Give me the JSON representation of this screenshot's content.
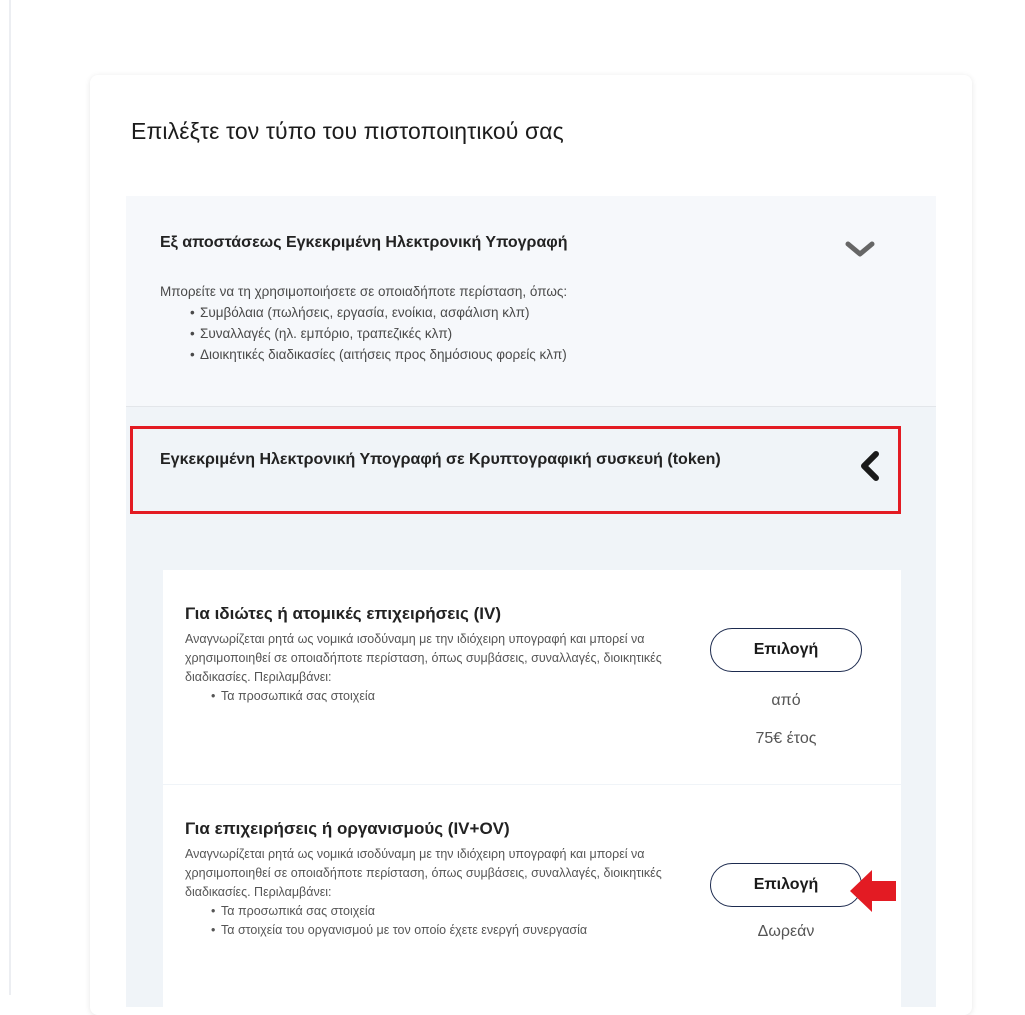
{
  "page": {
    "title": "Επιλέξτε τον τύπο του πιστοποιητικού σας"
  },
  "accordion": [
    {
      "title": "Εξ αποστάσεως Εγκεκριμένη Ηλεκτρονική Υπογραφή",
      "chevron_icon": "chevron-down-icon",
      "description_intro": "Μπορείτε να τη χρησιμοποιήσετε σε οποιαδήποτε περίσταση, όπως:",
      "bullets": [
        "Συμβόλαια (πωλήσεις, εργασία, ενοίκια, ασφάλιση κλπ)",
        "Συναλλαγές (ηλ. εμπόριο, τραπεζικές κλπ)",
        "Διοικητικές διαδικασίες (αιτήσεις προς δημόσιους φορείς κλπ)"
      ]
    },
    {
      "title": "Εγκεκριμένη Ηλεκτρονική Υπογραφή σε Κρυπτογραφική συσκευή (token)",
      "chevron_icon": "chevron-left-icon",
      "highlight_color": "#e31b23"
    }
  ],
  "options": [
    {
      "title": "Για ιδιώτες ή ατομικές επιχειρήσεις (IV)",
      "description": "Αναγνωρίζεται ρητά ως νομικά ισοδύναμη με την ιδιόχειρη υπογραφή και μπορεί να χρησιμοποιηθεί σε οποιαδήποτε περίσταση, όπως συμβάσεις, συναλλαγές, διοικητικές διαδικασίες. Περιλαμβάνει:",
      "bullets": [
        "Τα προσωπικά σας στοιχεία"
      ],
      "button_label": "Επιλογή",
      "price_prefix": "από",
      "price": "75€ έτος"
    },
    {
      "title": "Για επιχειρήσεις ή οργανισμούς (IV+OV)",
      "description": "Αναγνωρίζεται ρητά ως νομικά ισοδύναμη με την ιδιόχειρη υπογραφή και μπορεί να χρησιμοποιηθεί σε οποιαδήποτε περίσταση, όπως συμβάσεις, συναλλαγές, διοικητικές διαδικασίες. Περιλαμβάνει:",
      "bullets": [
        "Τα προσωπικά σας στοιχεία",
        "Τα στοιχεία του οργανισμού με τον οποίο έχετε ενεργή συνεργασία"
      ],
      "button_label": "Επιλογή",
      "price": "Δωρεάν"
    }
  ],
  "annotation": {
    "arrow_icon": "arrow-left-icon",
    "color": "#e31b23"
  }
}
